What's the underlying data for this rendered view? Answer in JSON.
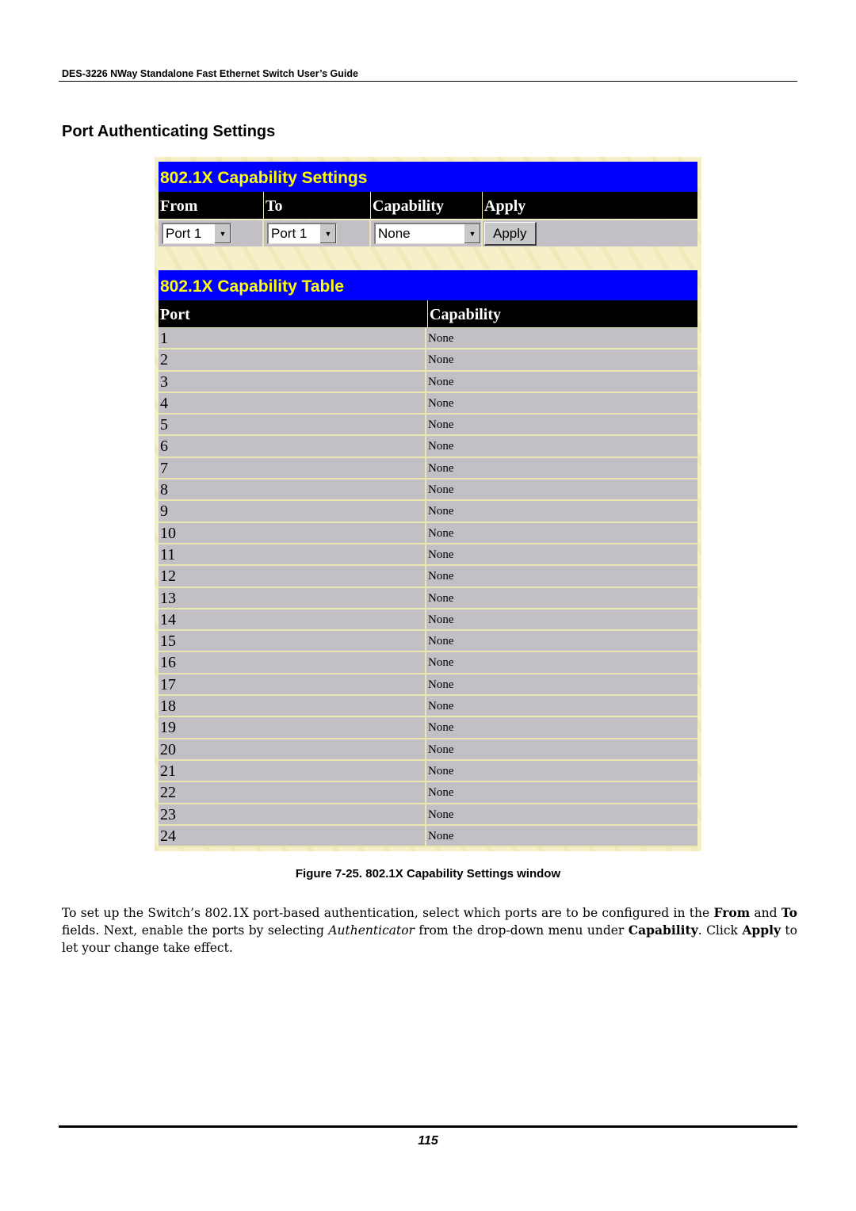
{
  "header": {
    "running_title": "DES-3226 NWay Standalone Fast Ethernet Switch User’s Guide"
  },
  "section_title": "Port Authenticating Settings",
  "window": {
    "settings": {
      "title": "802.1X Capability Settings",
      "columns": [
        "From",
        "To",
        "Capability",
        "Apply"
      ],
      "from_value": "Port 1",
      "to_value": "Port 1",
      "capability_value": "None",
      "apply_label": "Apply"
    },
    "table": {
      "title": "802.1X Capability Table",
      "columns": [
        "Port",
        "Capability"
      ],
      "rows": [
        {
          "port": "1",
          "capability": "None"
        },
        {
          "port": "2",
          "capability": "None"
        },
        {
          "port": "3",
          "capability": "None"
        },
        {
          "port": "4",
          "capability": "None"
        },
        {
          "port": "5",
          "capability": "None"
        },
        {
          "port": "6",
          "capability": "None"
        },
        {
          "port": "7",
          "capability": "None"
        },
        {
          "port": "8",
          "capability": "None"
        },
        {
          "port": "9",
          "capability": "None"
        },
        {
          "port": "10",
          "capability": "None"
        },
        {
          "port": "11",
          "capability": "None"
        },
        {
          "port": "12",
          "capability": "None"
        },
        {
          "port": "13",
          "capability": "None"
        },
        {
          "port": "14",
          "capability": "None"
        },
        {
          "port": "15",
          "capability": "None"
        },
        {
          "port": "16",
          "capability": "None"
        },
        {
          "port": "17",
          "capability": "None"
        },
        {
          "port": "18",
          "capability": "None"
        },
        {
          "port": "19",
          "capability": "None"
        },
        {
          "port": "20",
          "capability": "None"
        },
        {
          "port": "21",
          "capability": "None"
        },
        {
          "port": "22",
          "capability": "None"
        },
        {
          "port": "23",
          "capability": "None"
        },
        {
          "port": "24",
          "capability": "None"
        }
      ]
    }
  },
  "caption": "Figure 7-25.  802.1X Capability Settings window",
  "body": {
    "p1": "To set up the Switch’s 802.1X port-based authentication, select which ports are to be configured in the ",
    "b1": "From",
    "p2": " and ",
    "b2": "To",
    "p3": " fields. Next, enable the ports by selecting ",
    "i1": "Authenticator",
    "p4": " from the drop-down menu under ",
    "b3": "Capability",
    "p5": ". Click ",
    "b4": "Apply",
    "p6": " to let your change take effect."
  },
  "footer": {
    "page_number": "115"
  },
  "colors": {
    "title_bar": "#0000ff",
    "title_text": "#ffff00",
    "header_bg": "#000000",
    "row_bg": "#c3c0c5",
    "panel_bg": "#f5f0c8"
  }
}
